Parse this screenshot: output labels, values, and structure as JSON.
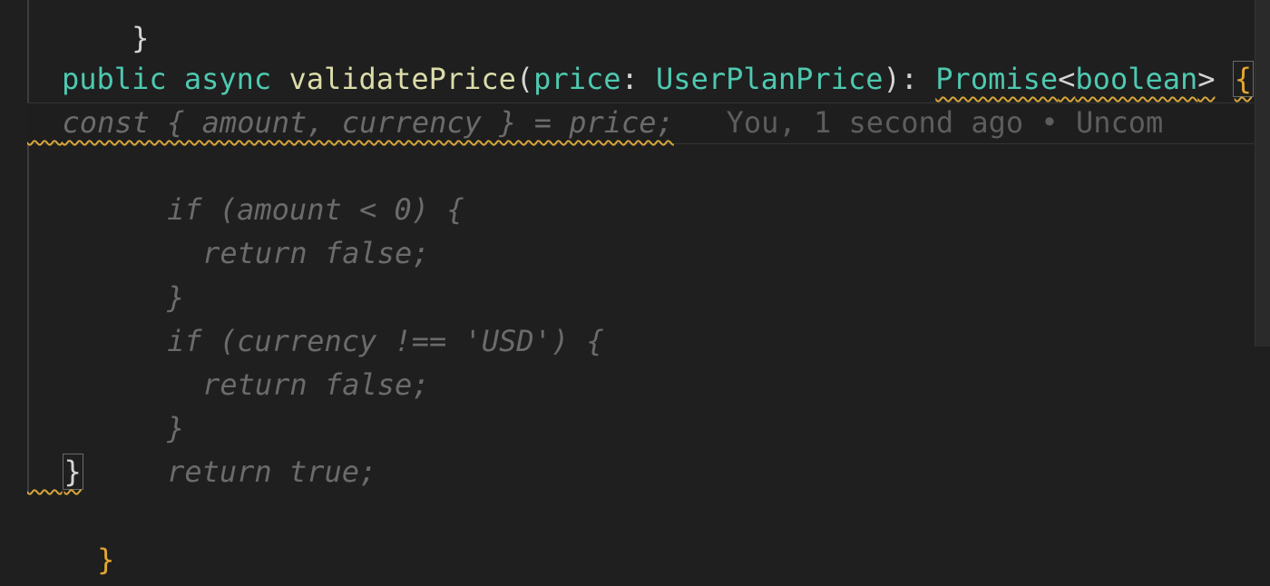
{
  "editor": {
    "lines": {
      "top_fragment": "}",
      "signature": {
        "kw_public": "public",
        "kw_async": "async",
        "fn_name": "validatePrice",
        "open_paren": "(",
        "param_name": "price",
        "colon": ":",
        "param_type": "UserPlanPrice",
        "close_paren_colon": "):",
        "return_type": "Promise",
        "lt": "<",
        "generic": "boolean",
        "gt": ">",
        "open_brace": "{"
      },
      "const_line": "const { amount, currency } = price;",
      "blame": "You, 1 second ago • Uncom",
      "if_amount": "if (amount < 0) {",
      "return_false_1": "return false;",
      "close_brace_1": "}",
      "if_currency": "if (currency !== 'USD') {",
      "return_false_2": "return false;",
      "close_brace_2": "}",
      "return_true": "return true;",
      "method_close": "}",
      "class_close": "}"
    }
  },
  "colors": {
    "background": "#1f1f1f",
    "keyword": "#4ec9b0",
    "function": "#dcdcaa",
    "ghost_text": "#6b6b6b",
    "warning_squiggle": "#d7a53a",
    "brace_yellow": "#e2a72e"
  }
}
